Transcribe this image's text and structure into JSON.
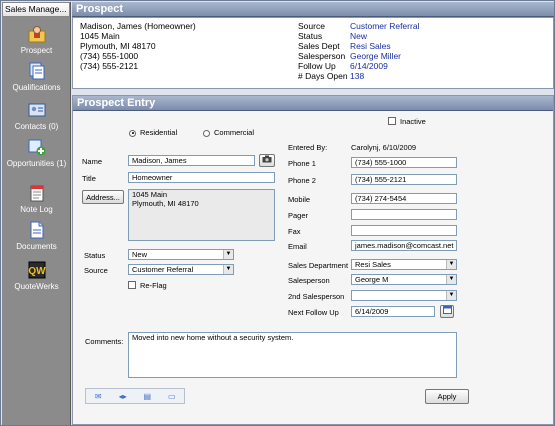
{
  "sidebar": {
    "title": "Sales Manage...",
    "items": [
      {
        "label": "Prospect",
        "icon": "person-folder-icon"
      },
      {
        "label": "Qualifications",
        "icon": "documents-icon"
      },
      {
        "label": "Contacts (0)",
        "icon": "address-card-icon"
      },
      {
        "label": "Opportunities (1)",
        "icon": "opportunity-plus-icon"
      },
      {
        "label": "Note Log",
        "icon": "notepad-icon"
      },
      {
        "label": "Documents",
        "icon": "document-icon"
      },
      {
        "label": "QuoteWerks",
        "icon": "quotewerks-icon"
      }
    ]
  },
  "prospect": {
    "heading": "Prospect",
    "name_line": "Madison, James  (Homeowner)",
    "address1": "1045 Main",
    "address2": "Plymouth, MI 48170",
    "phone1": "(734) 555-1000",
    "phone2": "(734) 555-2121",
    "summary": [
      {
        "k": "Source",
        "v": "Customer Referral"
      },
      {
        "k": "Status",
        "v": "New"
      },
      {
        "k": "Sales Dept",
        "v": "Resi Sales"
      },
      {
        "k": "Salesperson",
        "v": "George Miller"
      },
      {
        "k": "Follow Up",
        "v": "6/14/2009"
      },
      {
        "k": "# Days Open",
        "v": "138"
      }
    ]
  },
  "entry": {
    "heading": "Prospect Entry",
    "inactive_label": "Inactive",
    "radio_residential": "Residential",
    "radio_commercial": "Commercial",
    "entered_by_label": "Entered By:",
    "entered_by_value": "Carolynj, 6/10/2009",
    "name_label": "Name",
    "name_value": "Madison, James",
    "title_label": "Title",
    "title_value": "Homeowner",
    "address_button": "Address...",
    "address_line1": "1045 Main",
    "address_line2": "Plymouth, MI  48170",
    "status_label": "Status",
    "status_value": "New",
    "source_label": "Source",
    "source_value": "Customer Referral",
    "reflag_label": "Re-Flag",
    "phone1_label": "Phone 1",
    "phone1_value": "(734) 555-1000",
    "phone2_label": "Phone 2",
    "phone2_value": "(734) 555-2121",
    "mobile_label": "Mobile",
    "mobile_value": "(734) 274-5454",
    "pager_label": "Pager",
    "pager_value": "",
    "fax_label": "Fax",
    "fax_value": "",
    "email_label": "Email",
    "email_value": "james.madison@comcast.net",
    "dept_label": "Sales Department",
    "dept_value": "Resi Sales",
    "salesperson_label": "Salesperson",
    "salesperson_value": "George M",
    "salesperson2_label": "2nd Salesperson",
    "salesperson2_value": "",
    "followup_label": "Next Follow Up",
    "followup_value": "6/14/2009",
    "comments_label": "Comments:",
    "comments_value": "Moved into new home without a security system.",
    "apply_button": "Apply"
  }
}
